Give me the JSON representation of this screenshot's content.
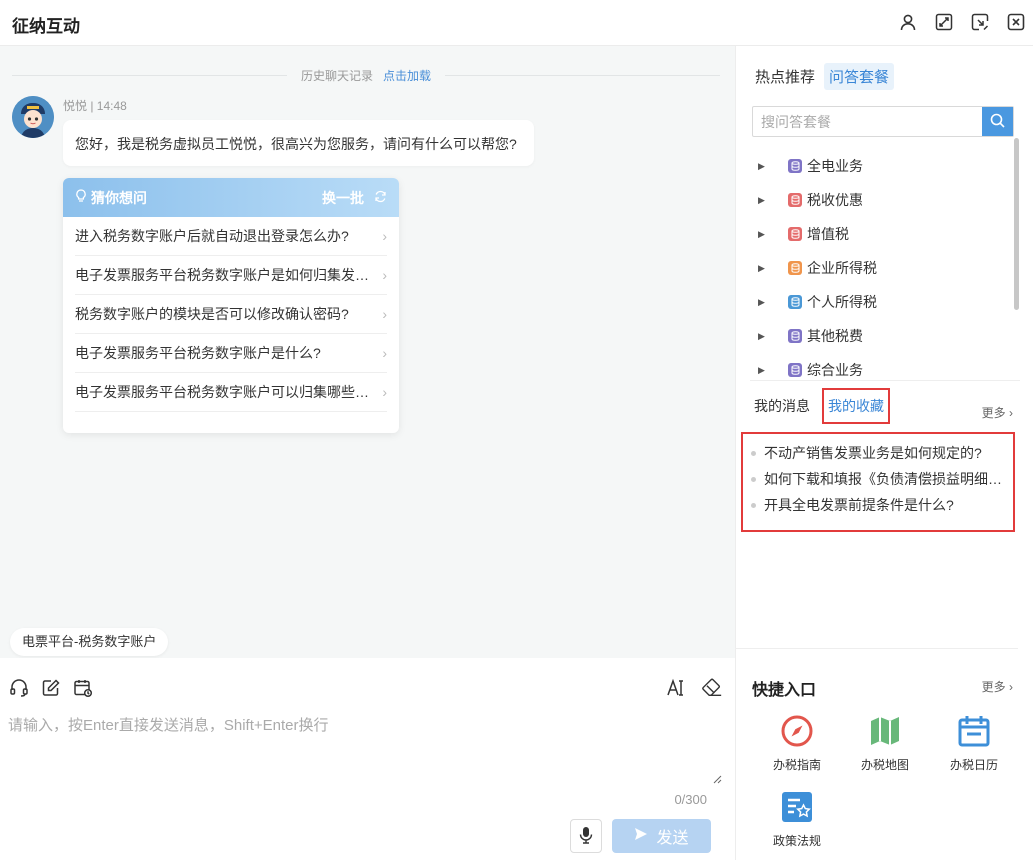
{
  "header": {
    "title": "征纳互动"
  },
  "chat": {
    "history_label": "历史聊天记录",
    "history_link": "点击加载",
    "message": {
      "sender": "悦悦 | 14:48",
      "text": "您好，我是税务虚拟员工悦悦，很高兴为您服务，请问有什么可以帮您?"
    },
    "guess": {
      "title": "猜你想问",
      "swap": "换一批",
      "items": [
        "进入税务数字账户后就自动退出登录怎么办?",
        "电子发票服务平台税务数字账户是如何归集发票的?",
        "税务数字账户的模块是否可以修改确认密码?",
        "电子发票服务平台税务数字账户是什么?",
        "电子发票服务平台税务数字账户可以归集哪些发票?"
      ]
    },
    "topic_chip": "电票平台-税务数字账户"
  },
  "input": {
    "placeholder": "请输入，按Enter直接发送消息，Shift+Enter换行",
    "value": "",
    "counter": "0/300",
    "send_label": "发送"
  },
  "side": {
    "tabs": [
      "热点推荐",
      "问答套餐"
    ],
    "search_placeholder": "搜问答套餐",
    "tree": [
      {
        "label": "全电业务",
        "color": "#7f74c6"
      },
      {
        "label": "税收优惠",
        "color": "#e46b6b"
      },
      {
        "label": "增值税",
        "color": "#e46b6b"
      },
      {
        "label": "企业所得税",
        "color": "#f0954c"
      },
      {
        "label": "个人所得税",
        "color": "#4a98d6"
      },
      {
        "label": "其他税费",
        "color": "#7f74c6"
      },
      {
        "label": "综合业务",
        "color": "#7f74c6"
      }
    ],
    "msg_tabs": [
      "我的消息",
      "我的收藏"
    ],
    "more": "更多",
    "favorites": [
      "不动产销售发票业务是如何规定的?",
      "如何下载和填报《负债清偿损益明细表》?",
      "开具全电发票前提条件是什么?"
    ],
    "quick": {
      "title": "快捷入口",
      "more": "更多",
      "items": [
        {
          "label": "办税指南",
          "icon": "compass-icon",
          "color": "#e2564c"
        },
        {
          "label": "办税地图",
          "icon": "map-icon",
          "color": "#68b87a"
        },
        {
          "label": "办税日历",
          "icon": "calendar-icon",
          "color": "#3d8fd8"
        },
        {
          "label": "政策法规",
          "icon": "policy-book-icon",
          "color": "#3d8fd8"
        }
      ]
    }
  }
}
